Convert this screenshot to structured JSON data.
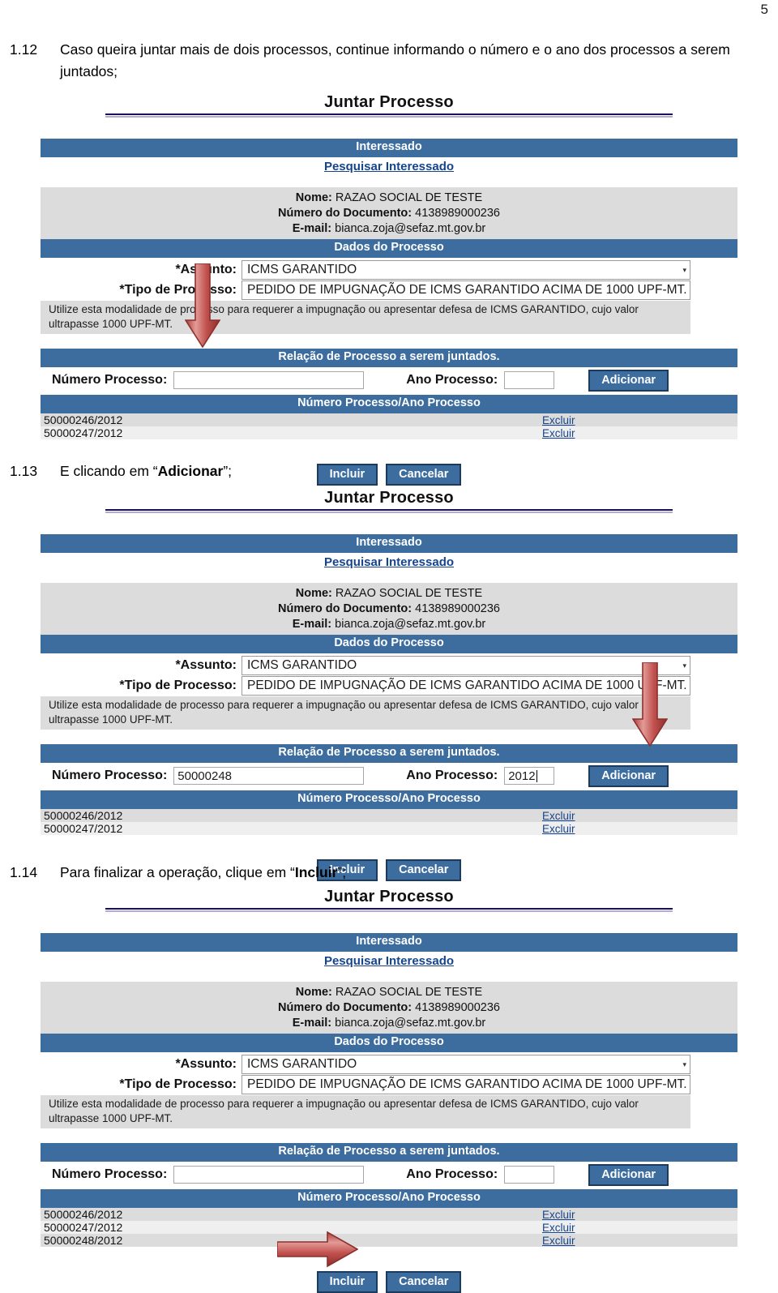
{
  "page": {
    "number": "5"
  },
  "steps": [
    {
      "num": "1.12",
      "text_before": "Caso queira juntar mais de dois processos, continue informando o número e o ano dos processos a serem juntados;",
      "bold": "",
      "text_after": ""
    },
    {
      "num": "1.13",
      "text_before": "E clicando em “",
      "bold": "Adicionar",
      "text_after": "”;"
    },
    {
      "num": "1.14",
      "text_before": "Para finalizar a operação, clique em “",
      "bold": "Incluir",
      "text_after": "”;"
    }
  ],
  "form": {
    "title": "Juntar Processo",
    "interessado_band": "Interessado",
    "pesquisar_link": "Pesquisar Interessado",
    "info": {
      "nome_label": "Nome:",
      "nome_value": "RAZAO SOCIAL DE TESTE",
      "documento_label": "Número do Documento:",
      "documento_value": "4138989000236",
      "email_label": "E-mail:",
      "email_value": "bianca.zoja@sefaz.mt.gov.br"
    },
    "dados_band": "Dados do Processo",
    "assunto_label": "*Assunto:",
    "assunto_value": "ICMS GARANTIDO",
    "tipo_label": "*Tipo de Processo:",
    "tipo_value": "PEDIDO DE IMPUGNAÇÃO DE ICMS GARANTIDO ACIMA DE 1000 UPF-MT.",
    "help_text": "Utilize esta modalidade de processo para requerer a impugnação ou apresentar defesa de ICMS GARANTIDO, cujo valor ultrapasse 1000 UPF-MT.",
    "relacao_band": "Relação de Processo a serem juntados.",
    "numero_label": "Número Processo:",
    "ano_label": "Ano Processo:",
    "adicionar_label": "Adicionar",
    "list_header": "Número Processo/Ano Processo",
    "excluir_label": "Excluir",
    "incluir_label": "Incluir",
    "cancelar_label": "Cancelar",
    "caret_glyph": "▾"
  },
  "screens": [
    {
      "id": "screen-1",
      "numero_value": "",
      "ano_value": "",
      "show_text_caret": false,
      "rows": [
        "50000246/2012",
        "50000247/2012"
      ],
      "arrow": "down-left"
    },
    {
      "id": "screen-2",
      "numero_value": "50000248",
      "ano_value": "2012",
      "show_text_caret": true,
      "rows": [
        "50000246/2012",
        "50000247/2012"
      ],
      "arrow": "down-right"
    },
    {
      "id": "screen-3",
      "numero_value": "",
      "ano_value": "",
      "show_text_caret": false,
      "rows": [
        "50000246/2012",
        "50000247/2012",
        "50000248/2012"
      ],
      "arrow": "right-incluir"
    }
  ],
  "colors": {
    "band_blue": "#3d6d9e",
    "panel_grey": "#dcdcdc",
    "link_blue": "#16448c",
    "arrow_red": "#c0504d",
    "rule_navy": "#16135a",
    "rule_purple": "#b7a9d6"
  }
}
